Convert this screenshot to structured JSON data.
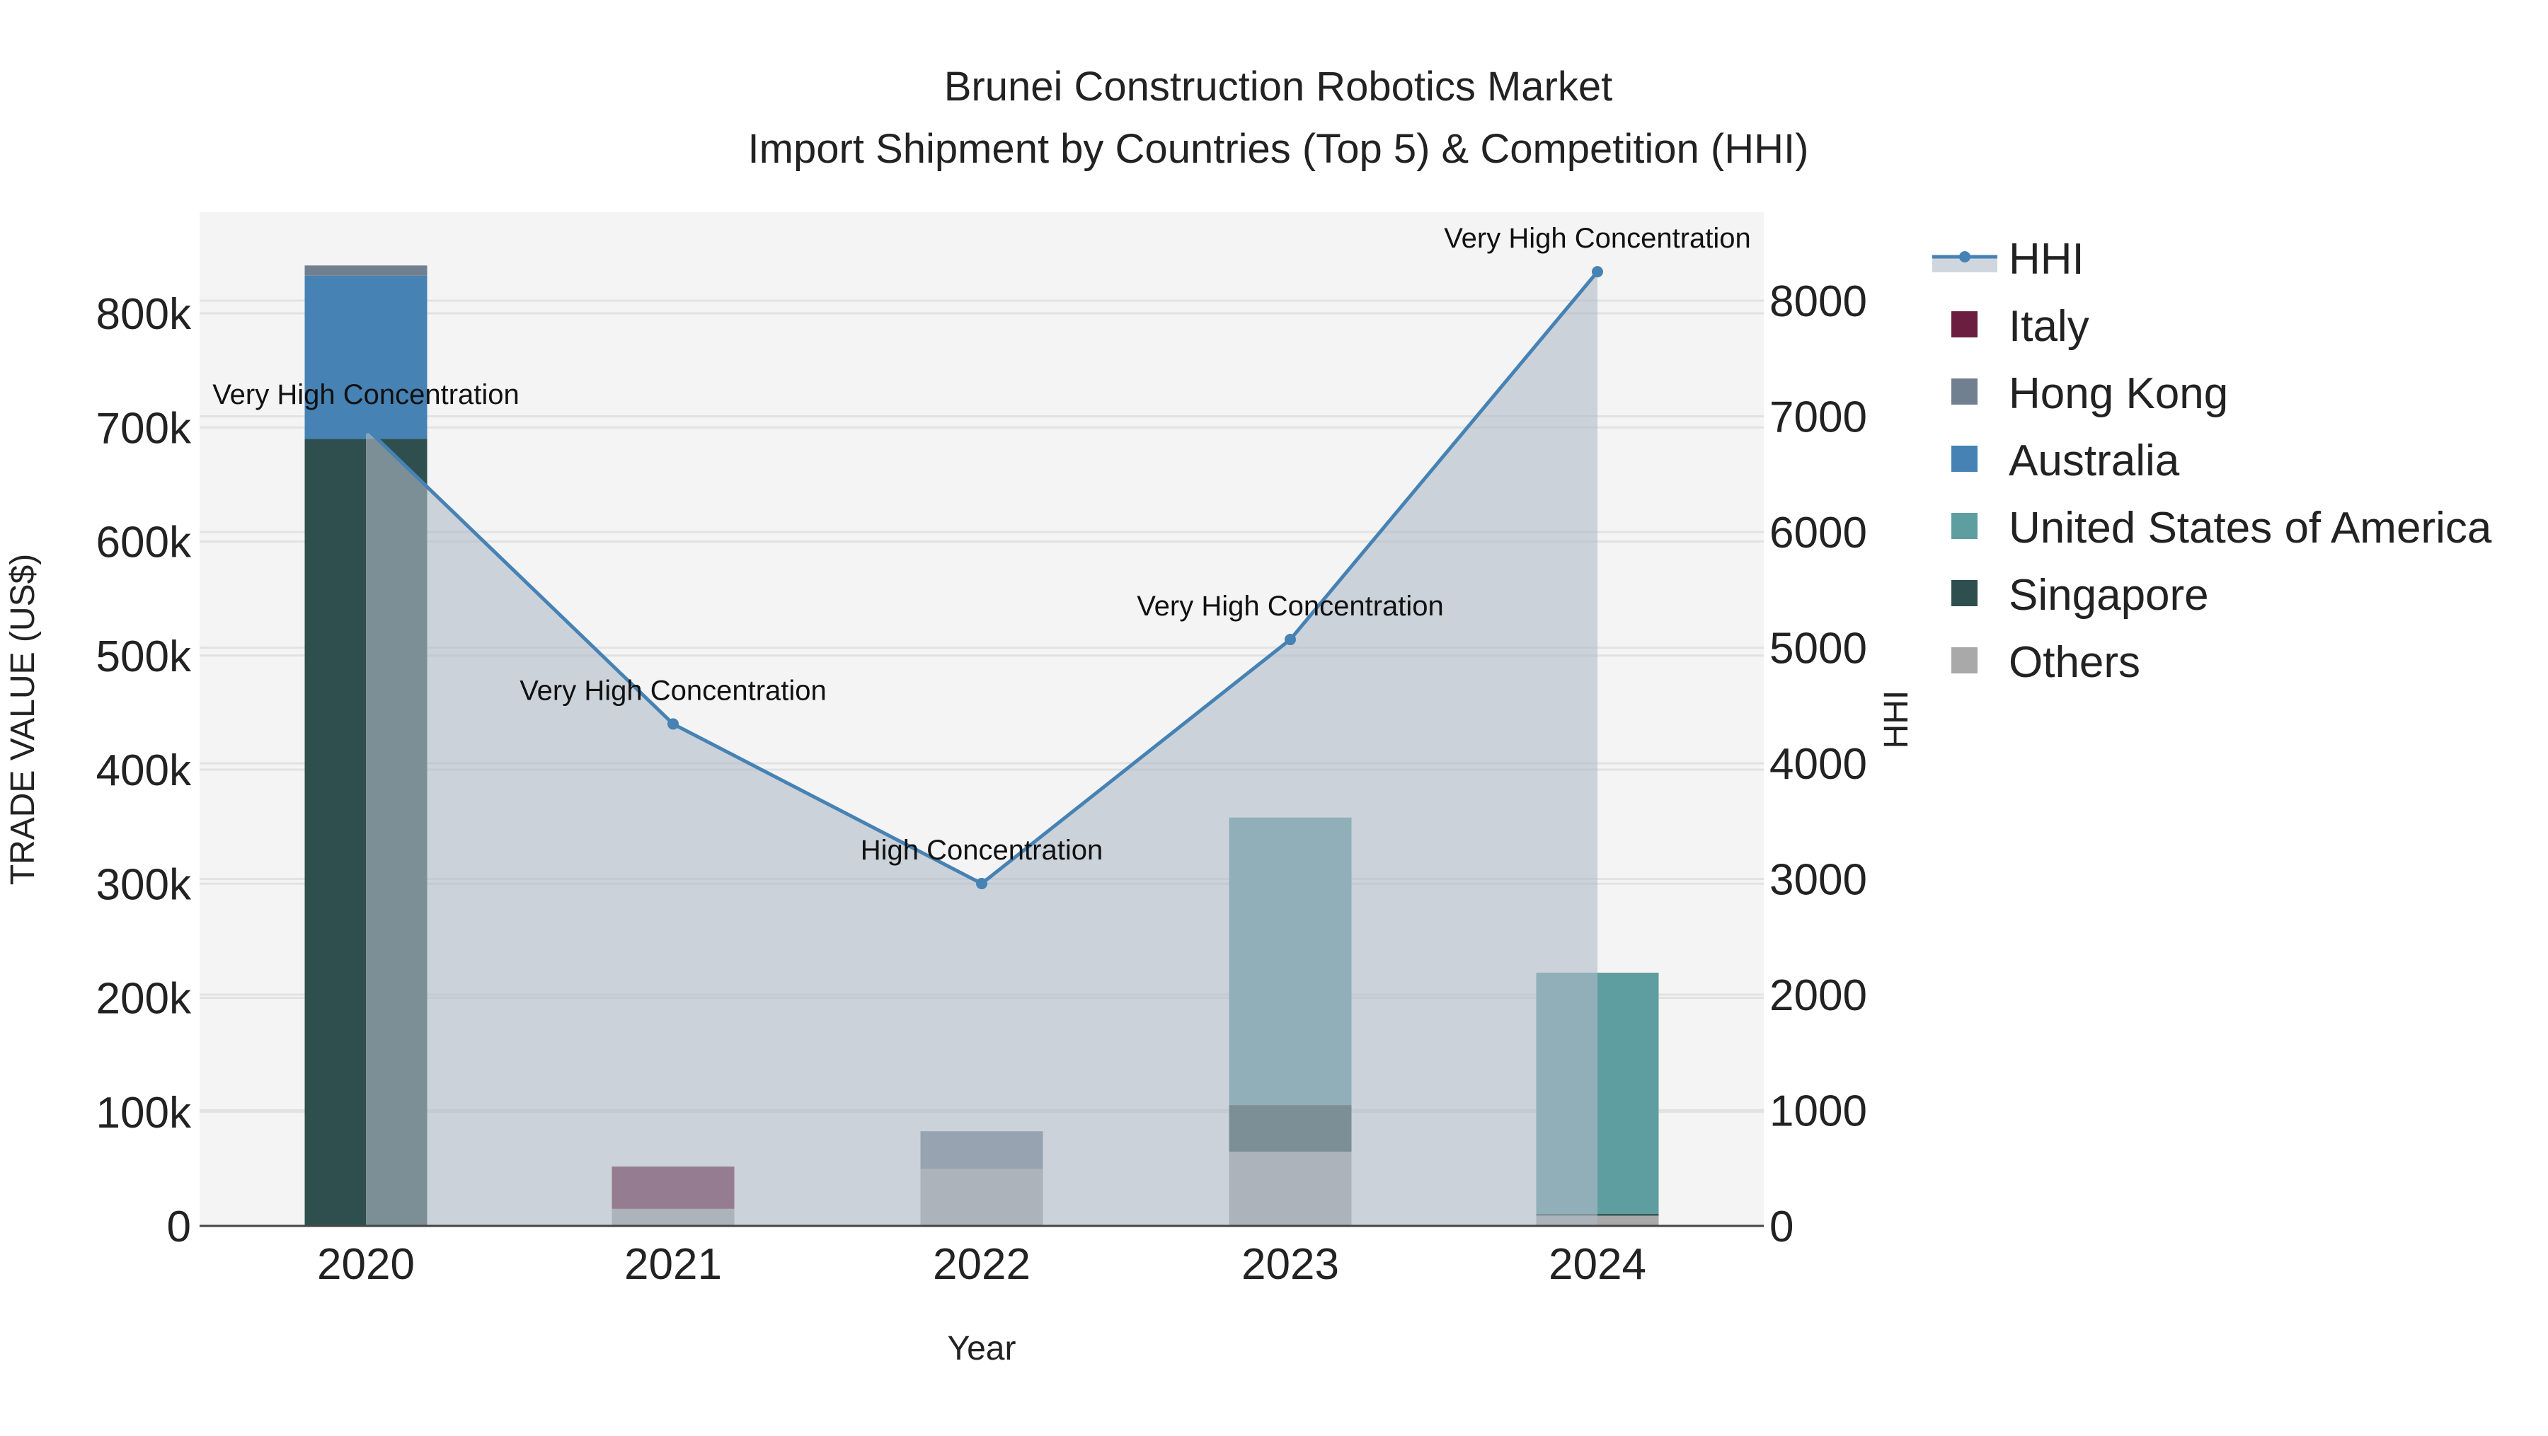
{
  "chart_data": {
    "type": "bar",
    "title": "Brunei Construction Robotics Market",
    "subtitle": "Import Shipment by Countries (Top 5) & Competition (HHI)",
    "xlabel": "Year",
    "ylabel": "TRADE VALUE (US$)",
    "y2label": "HHI",
    "categories": [
      "2020",
      "2021",
      "2022",
      "2023",
      "2024"
    ],
    "ylim": [
      0,
      880000
    ],
    "y2lim": [
      0,
      8750
    ],
    "yticks": [
      0,
      100000,
      200000,
      300000,
      400000,
      500000,
      600000,
      700000,
      800000
    ],
    "ytick_labels": [
      "0",
      "100k",
      "200k",
      "300k",
      "400k",
      "500k",
      "600k",
      "700k",
      "800k"
    ],
    "y2ticks": [
      0,
      1000,
      2000,
      3000,
      4000,
      5000,
      6000,
      7000,
      8000
    ],
    "y2tick_labels": [
      "0",
      "1000",
      "2000",
      "3000",
      "4000",
      "5000",
      "6000",
      "7000",
      "8000"
    ],
    "grid": true,
    "legend_position": "right",
    "series": [
      {
        "name": "Others",
        "color": "#a9a9a9",
        "values": [
          0,
          15000,
          50000,
          65000,
          9000
        ]
      },
      {
        "name": "Singapore",
        "color": "#2f4f4f",
        "values": [
          690000,
          0,
          0,
          41000,
          1500
        ]
      },
      {
        "name": "United States of America",
        "color": "#5f9ea0",
        "values": [
          0,
          0,
          0,
          252000,
          211500
        ]
      },
      {
        "name": "Australia",
        "color": "#4682b4",
        "values": [
          143000,
          0,
          0,
          0,
          0
        ]
      },
      {
        "name": "Hong Kong",
        "color": "#708090",
        "values": [
          9000,
          0,
          33000,
          0,
          0
        ]
      },
      {
        "name": "Italy",
        "color": "#6b1e3f",
        "values": [
          0,
          37000,
          0,
          0,
          0
        ]
      }
    ],
    "hhi": {
      "name": "HHI",
      "color": "#4682b4",
      "values": [
        6900,
        4340,
        2960,
        5070,
        8250
      ],
      "annotations": [
        "Very High Concentration",
        "Very High Concentration",
        "High Concentration",
        "Very High Concentration",
        "Very High Concentration"
      ]
    },
    "legend_order": [
      "HHI",
      "Italy",
      "Hong Kong",
      "Australia",
      "United States of America",
      "Singapore",
      "Others"
    ]
  }
}
